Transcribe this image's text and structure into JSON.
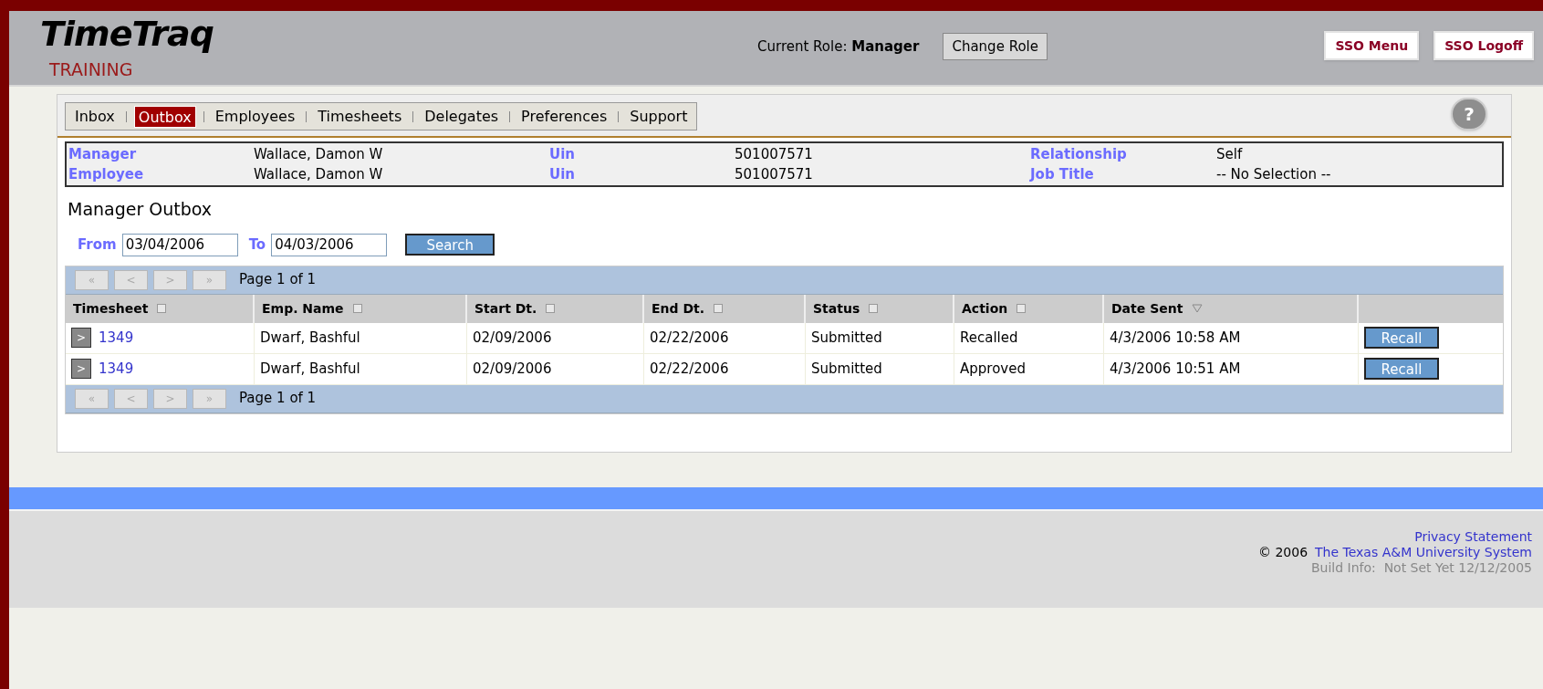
{
  "header": {
    "logo": "TimeTraq",
    "subtitle": "TRAINING",
    "role_label": "Current Role:",
    "role": "Manager",
    "change_role": "Change Role",
    "sso_buttons": [
      "SSO Menu",
      "SSO Logoff"
    ]
  },
  "tabs": [
    {
      "label": "Inbox",
      "selected": false
    },
    {
      "label": "Outbox",
      "selected": true
    },
    {
      "label": "Employees",
      "selected": false
    },
    {
      "label": "Timesheets",
      "selected": false
    },
    {
      "label": "Delegates",
      "selected": false
    },
    {
      "label": "Preferences",
      "selected": false
    },
    {
      "label": "Support",
      "selected": false
    }
  ],
  "info": [
    [
      {
        "label": "Manager",
        "value": "Wallace, Damon W"
      },
      {
        "label": "Uin",
        "value": "501007571"
      },
      {
        "label": "Relationship",
        "value": "Self"
      }
    ],
    [
      {
        "label": "Employee",
        "value": "Wallace, Damon W"
      },
      {
        "label": "Uin",
        "value": "501007571"
      },
      {
        "label": "Job Title",
        "value": "-- No Selection --"
      }
    ]
  ],
  "page_title": "Manager Outbox",
  "filter": {
    "from_label": "From",
    "from": "03/04/2006",
    "to_label": "To",
    "to": "04/03/2006",
    "search": "Search"
  },
  "help": "?",
  "pagers": [
    {
      "buttons": [
        "«",
        "<",
        ">",
        "»"
      ],
      "text": "Page 1 of 1"
    },
    {
      "buttons": [
        "«",
        "<",
        ">",
        "»"
      ],
      "text": "Page 1 of 1"
    }
  ],
  "table": {
    "columns": [
      {
        "label": "Timesheet",
        "sorted": false
      },
      {
        "label": "Emp. Name",
        "sorted": false
      },
      {
        "label": "Start Dt.",
        "sorted": false
      },
      {
        "label": "End Dt.",
        "sorted": false
      },
      {
        "label": "Status",
        "sorted": false
      },
      {
        "label": "Action",
        "sorted": false
      },
      {
        "label": "Date Sent",
        "sorted": true
      }
    ],
    "rows": [
      {
        "expand": ">",
        "cells": [
          "1349",
          "Dwarf, Bashful",
          "02/09/2006",
          "02/22/2006",
          "Submitted",
          "Recalled",
          "4/3/2006 10:58 AM"
        ],
        "button": "Recall"
      },
      {
        "expand": ">",
        "cells": [
          "1349",
          "Dwarf, Bashful",
          "02/09/2006",
          "02/22/2006",
          "Submitted",
          "Approved",
          "4/3/2006 10:51 AM"
        ],
        "button": "Recall"
      }
    ]
  },
  "footer": {
    "privacy": "Privacy Statement",
    "copyright": "© 2006",
    "org": "The Texas A&M University System",
    "build": "Build Info:  Not Set Yet 12/12/2005"
  }
}
